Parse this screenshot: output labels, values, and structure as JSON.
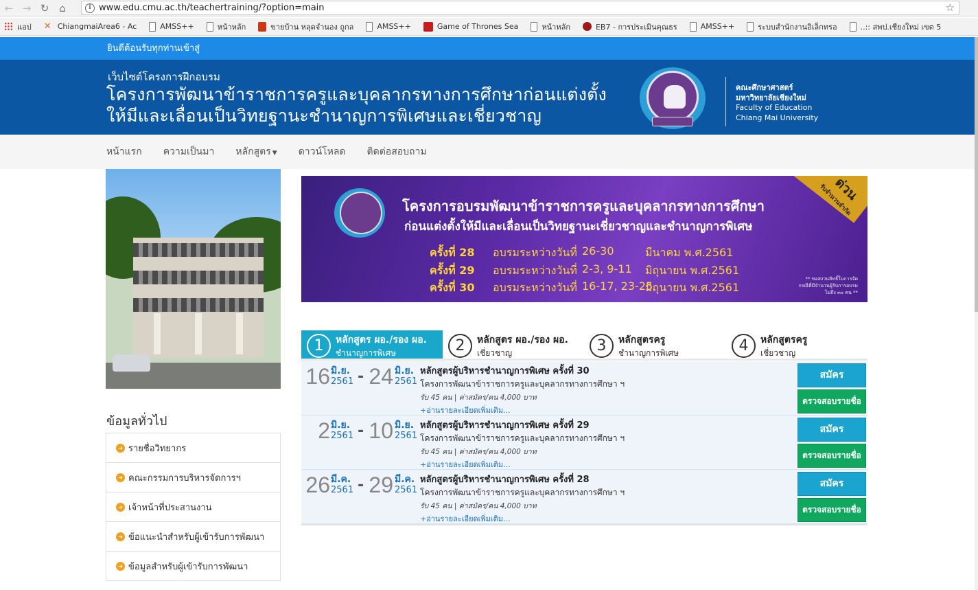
{
  "browser": {
    "url": "www.edu.cmu.ac.th/teachertraining/?option=main",
    "bookmarks": [
      {
        "label": "แอป",
        "icon": "apps-icon"
      },
      {
        "label": "ChiangmaiArea6 - Ac",
        "icon": "x-logo-icon"
      },
      {
        "label": "AMSS++",
        "icon": "page-icon"
      },
      {
        "label": "หน้าหลัก",
        "icon": "page-icon"
      },
      {
        "label": "ขายบ้าน หลุดจำนอง ถูกล",
        "icon": "house-icon"
      },
      {
        "label": "AMSS++",
        "icon": "page-icon"
      },
      {
        "label": "Game of Thrones Sea",
        "icon": "red-badge-icon"
      },
      {
        "label": "หน้าหลัก",
        "icon": "page-icon"
      },
      {
        "label": "EB7 - การประเมินคุณธร",
        "icon": "apple-icon"
      },
      {
        "label": "AMSS++",
        "icon": "page-icon"
      },
      {
        "label": "ระบบสำนักงานอิเล็กทรอ",
        "icon": "page-icon"
      },
      {
        "label": "..:: สพป.เชียงใหม่ เขต 5",
        "icon": "page-icon"
      }
    ]
  },
  "site": {
    "welcome": "ยินดีต้อนรับทุกท่านเข้าสู่",
    "subtitle": "เว็บไซต์โครงการฝึกอบรม",
    "title_line1": "โครงการพัฒนาข้าราชการครูและบุคลากรทางการศึกษาก่อนแต่งตั้ง",
    "title_line2": "ให้มีและเลื่อนเป็นวิทยฐานะชำนาญการพิเศษและเชี่ยวชาญ",
    "faculty_th1": "คณะศึกษาศาสตร์",
    "faculty_th2": "มหาวิทยาลัยเชียงใหม่",
    "faculty_en1": "Faculty of Education",
    "faculty_en2": "Chiang Mai University"
  },
  "menu": {
    "home": "หน้าแรก",
    "history": "ความเป็นมา",
    "courses": "หลักสูตร",
    "download": "ดาวน์โหลด",
    "contact": "ติดต่อสอบถาม"
  },
  "sidebar": {
    "title": "ข้อมูลทั่วไป",
    "items": [
      "รายชื่อวิทยากร",
      "คณะกรรมการบริหารจัดการฯ",
      "เจ้าหน้าที่ประสานงาน",
      "ข้อแนะนำสำหรับผู้เข้ารับการพัฒนา",
      "ข้อมูลสำหรับผู้เข้ารับการพัฒนา"
    ]
  },
  "banner": {
    "line1": "โครงการอบรมพัฒนาข้าราชการครูและบุคลากรทางการศึกษา",
    "line2": "ก่อนแต่งตั้งให้มีและเลื่อนเป็นวิทยฐานะเชี่ยวชาญและชำนาญการพิเศษ",
    "schedule": [
      {
        "no": "ครั้งที่ 28",
        "label": "อบรมระหว่างวันที่",
        "dates": "26-30",
        "month": "มีนาคม   พ.ศ.2561"
      },
      {
        "no": "ครั้งที่ 29",
        "label": "อบรมระหว่างวันที่",
        "dates": "2-3, 9-11",
        "month": "มิถุนายน  พ.ศ.2561"
      },
      {
        "no": "ครั้งที่ 30",
        "label": "อบรมระหว่างวันที่",
        "dates": "16-17, 23-25",
        "month": "มิถุนายน  พ.ศ.2561"
      }
    ],
    "corner": "ด่วน",
    "corner_sub": "รับจำนวนจำกัด",
    "note1": "** ขอสงวนสิทธิ์ในการจัด",
    "note2": "กรณีที่มีจำนวนผู้รับการอบรม",
    "note3": "ไม่ถึง ๓๐ คน **"
  },
  "tabs": [
    {
      "num": "1",
      "line1": "หลักสูตร ผอ./รอง ผอ.",
      "line2": "ชำนาญการพิเศษ",
      "active": true
    },
    {
      "num": "2",
      "line1": "หลักสูตร ผอ./รอง ผอ.",
      "line2": "เชี่ยวชาญ",
      "active": false
    },
    {
      "num": "3",
      "line1": "หลักสูตรครู",
      "line2": "ชำนาญการพิเศษ",
      "active": false
    },
    {
      "num": "4",
      "line1": "หลักสูตรครู",
      "line2": "เชี่ยวชาญ",
      "active": false
    }
  ],
  "courses": [
    {
      "start_day": "16",
      "start_month": "มิ.ย.",
      "start_year": "2561",
      "end_day": "24",
      "end_month": "มิ.ย.",
      "end_year": "2561",
      "title": "หลักสูตรผู้บริหารชำนาญการพิเศษ ครั้งที่ 30",
      "desc": "โครงการพัฒนาข้าราชการครูและบุคลากรทางการศึกษา ฯ",
      "fee": "รับ 45 คน | ค่าสมัคร/คน 4,000 บาท",
      "more": "+อ่านรายละเอียดเพิ่มเติม...",
      "apply": "สมัคร",
      "check": "ตรวจสอบรายชื่อ"
    },
    {
      "start_day": "2",
      "start_month": "มิ.ย.",
      "start_year": "2561",
      "end_day": "10",
      "end_month": "มิ.ย.",
      "end_year": "2561",
      "title": "หลักสูตรผู้บริหารชำนาญการพิเศษ ครั้งที่ 29",
      "desc": "โครงการพัฒนาข้าราชการครูและบุคลากรทางการศึกษา ฯ",
      "fee": "รับ 45 คน | ค่าสมัคร/คน 4,000 บาท",
      "more": "+อ่านรายละเอียดเพิ่มเติม...",
      "apply": "สมัคร",
      "check": "ตรวจสอบรายชื่อ"
    },
    {
      "start_day": "26",
      "start_month": "มี.ค.",
      "start_year": "2561",
      "end_day": "29",
      "end_month": "มี.ค.",
      "end_year": "2561",
      "title": "หลักสูตรผู้บริหารชำนาญการพิเศษ ครั้งที่ 28",
      "desc": "โครงการพัฒนาข้าราชการครูและบุคลากรทางการศึกษา ฯ",
      "fee": "รับ 45 คน | ค่าสมัคร/คน 4,000 บาท",
      "more": "+อ่านรายละเอียดเพิ่มเติม...",
      "apply": "สมัคร",
      "check": "ตรวจสอบรายชื่อ"
    }
  ]
}
